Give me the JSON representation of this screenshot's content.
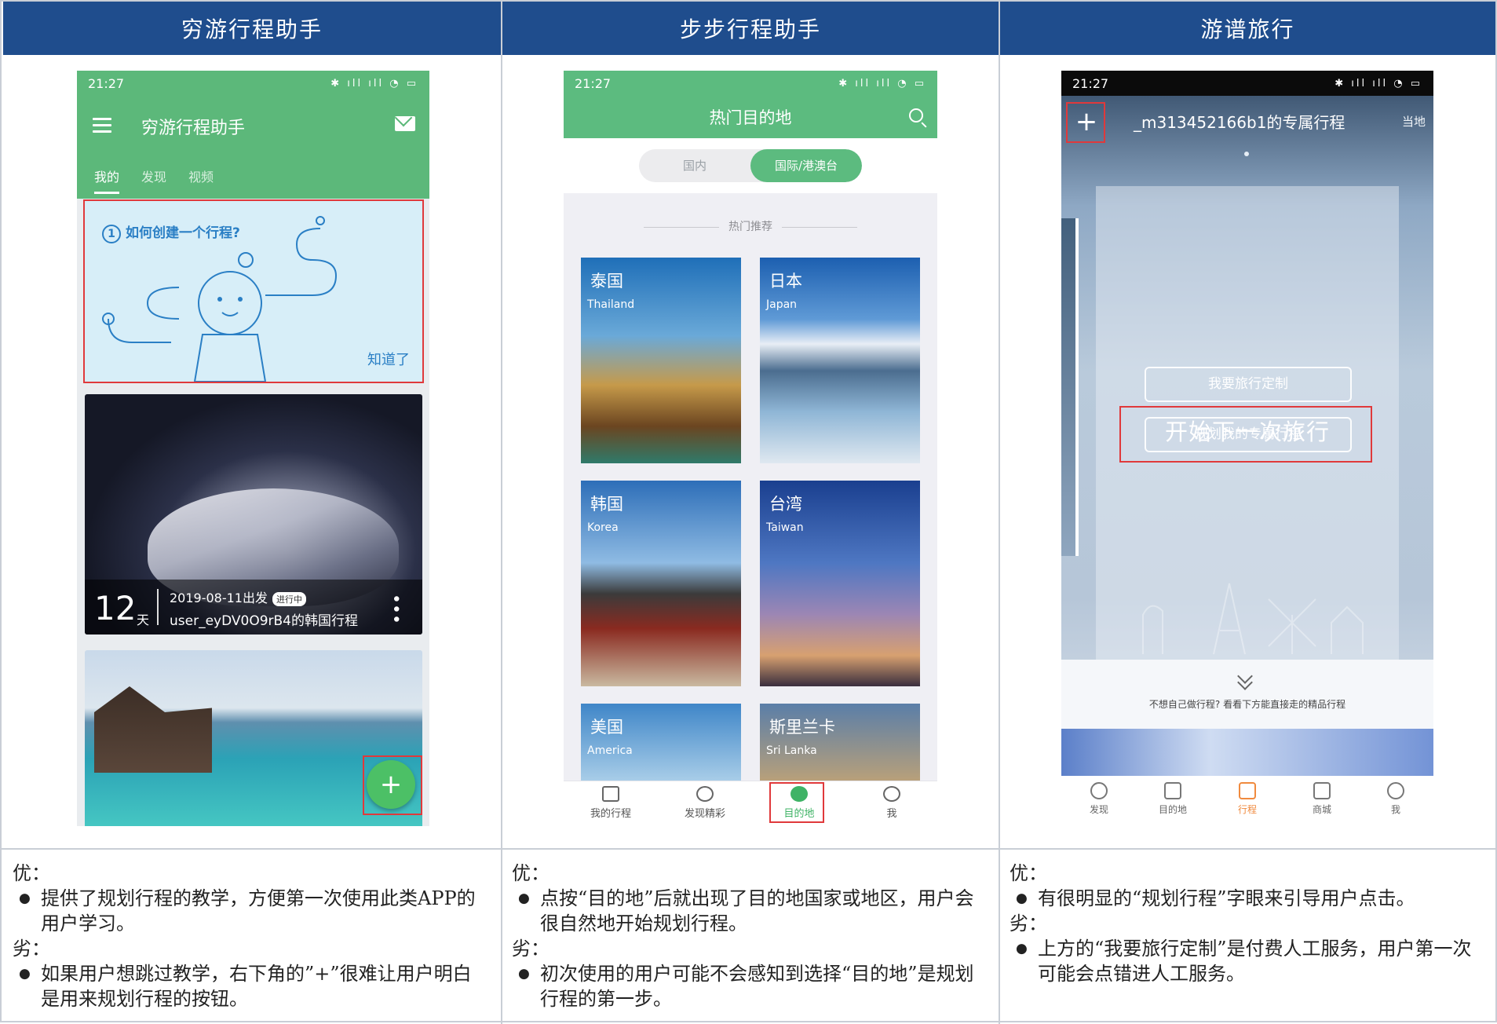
{
  "columns": [
    {
      "title": "穷游行程助手"
    },
    {
      "title": "步步行程助手"
    },
    {
      "title": "游谱旅行"
    }
  ],
  "phone1": {
    "status_time": "21:27",
    "app_title": "穷游行程助手",
    "tabs": [
      "我的",
      "发现",
      "视频"
    ],
    "guide_question_num": "1",
    "guide_question": "如何创建一个行程?",
    "guide_ok": "知道了",
    "trip_days": "12",
    "trip_days_unit": "天",
    "trip_date": "2019-08-11出发",
    "trip_badge": "进行中",
    "trip_name": "user_eyDV0O9rB4的韩国行程",
    "fab_label": "+"
  },
  "phone2": {
    "status_time": "21:27",
    "title": "热门目的地",
    "segments": [
      "国内",
      "国际/港澳台"
    ],
    "section": "热门推荐",
    "destinations": [
      {
        "cn": "泰国",
        "en": "Thailand"
      },
      {
        "cn": "日本",
        "en": "Japan"
      },
      {
        "cn": "韩国",
        "en": "Korea"
      },
      {
        "cn": "台湾",
        "en": "Taiwan"
      },
      {
        "cn": "美国",
        "en": "America"
      },
      {
        "cn": "斯里兰卡",
        "en": "Sri Lanka"
      }
    ],
    "nav": [
      "我的行程",
      "发现精彩",
      "目的地",
      "我"
    ]
  },
  "phone3": {
    "status_time": "21:27",
    "plus": "+",
    "title": "_m313452166b1的专属行程",
    "local": "当地",
    "start": "开始下一次旅行",
    "btn_custom": "我要旅行定制",
    "btn_plan": "规划我的专属行程",
    "hint": "不想自己做行程? 看看下方能直接走的精品行程",
    "nav": [
      "发现",
      "目的地",
      "行程",
      "商城",
      "我"
    ]
  },
  "notes": [
    {
      "pro_label": "优：",
      "pros": [
        "提供了规划行程的教学，方便第一次使用此类APP的用户学习。"
      ],
      "con_label": "劣：",
      "cons": [
        "如果用户想跳过教学，右下角的”+”很难让用户明白是用来规划行程的按钮。"
      ]
    },
    {
      "pro_label": "优：",
      "pros": [
        "点按“目的地”后就出现了目的地国家或地区，用户会很自然地开始规划行程。"
      ],
      "con_label": "劣：",
      "cons": [
        "初次使用的用户可能不会感知到选择“目的地”是规划行程的第一步。"
      ]
    },
    {
      "pro_label": "优：",
      "pros": [
        "有很明显的“规划行程”字眼来引导用户点击。"
      ],
      "con_label": "劣：",
      "cons": [
        "上方的“我要旅行定制”是付费人工服务，用户第一次可能会点错进人工服务。"
      ]
    }
  ],
  "colors": {
    "header_blue": "#1f4d8d",
    "green": "#5cb87a",
    "highlight_red": "#e0393b",
    "orange": "#f08a3e"
  }
}
